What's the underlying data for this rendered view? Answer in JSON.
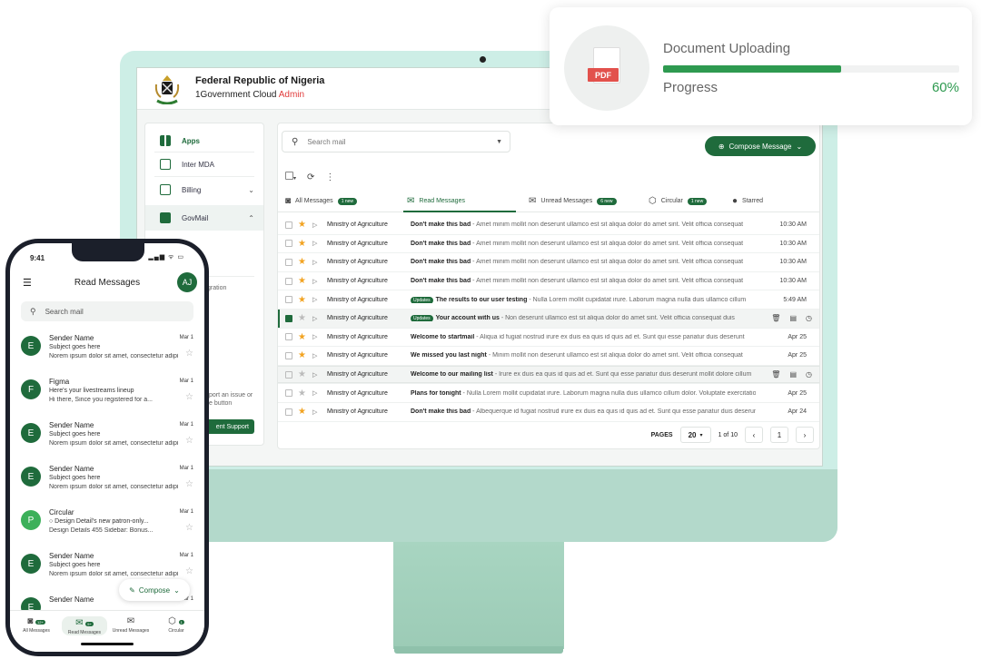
{
  "upload": {
    "title": "Document Uploading",
    "file_type": "PDF",
    "progress_label": "Progress",
    "progress_text": "60%",
    "progress_fraction": 0.6
  },
  "app": {
    "title": "Federal Republic of Nigeria",
    "subtitle": "1Government Cloud",
    "subtitle_accent": "Admin"
  },
  "sidebar": {
    "items": [
      {
        "label": "Apps",
        "icon": "apps-grid-icon"
      },
      {
        "label": "Inter MDA",
        "icon": "document-icon"
      },
      {
        "label": "Billing",
        "icon": "billing-icon",
        "chevron": "⌄"
      },
      {
        "label": "GovMail",
        "icon": "mail-icon",
        "chevron": "⌃"
      }
    ],
    "fragment_1": "gration",
    "fragment_2": "port an issue or",
    "fragment_3": "e button",
    "support_button": "ent Support"
  },
  "mail": {
    "search_placeholder": "Search mail",
    "compose_label": "Compose Message",
    "tabs": [
      {
        "label": "All Messages",
        "badge": "1 new",
        "icon": "inbox-icon"
      },
      {
        "label": "Read Messages",
        "badge": "",
        "icon": "open-mail-icon"
      },
      {
        "label": "Unread Messages",
        "badge": "6 new",
        "icon": "unread-mail-icon"
      },
      {
        "label": "Circular",
        "badge": "1 new",
        "icon": "circular-icon"
      },
      {
        "label": "Starred",
        "badge": "",
        "icon": "info-icon"
      }
    ],
    "rows": [
      {
        "sender": "Ministry of Agriculture",
        "tag": "",
        "subject": "Don't make this bad",
        "preview": " - Amet minim mollit non deserunt ullamco est sit aliqua dolor do amet sint. Velit officia consequat",
        "time": "10:30 AM",
        "starred": true,
        "checked": false
      },
      {
        "sender": "Ministry of Agriculture",
        "tag": "",
        "subject": "Don't make this bad",
        "preview": " - Amet minim mollit non deserunt ullamco est sit aliqua dolor do amet sint. Velit officia consequat",
        "time": "10:30 AM",
        "starred": true,
        "checked": false
      },
      {
        "sender": "Ministry of Agriculture",
        "tag": "",
        "subject": "Don't make this bad",
        "preview": " - Amet minim mollit non deserunt ullamco est sit aliqua dolor do amet sint. Velit officia consequat",
        "time": "10:30 AM",
        "starred": true,
        "checked": false
      },
      {
        "sender": "Ministry of Agriculture",
        "tag": "",
        "subject": "Don't make this bad",
        "preview": " - Amet minim mollit non deserunt ullamco est sit aliqua dolor do amet sint. Velit officia consequat",
        "time": "10:30 AM",
        "starred": true,
        "checked": false
      },
      {
        "sender": "Ministry of Agriculture",
        "tag": "Updates",
        "subject": "The results to our user testing",
        "preview": " - Nulla Lorem mollit cupidatat irure. Laborum magna nulla duis ullamco cillum",
        "time": "5:49 AM",
        "starred": true,
        "checked": false
      },
      {
        "sender": "Ministry of Agriculture",
        "tag": "Updates",
        "subject": "Your account with us",
        "preview": " - Non deserunt ullamco est sit aliqua dolor do amet sint. Velit officia consequat duis",
        "time": "",
        "starred": false,
        "checked": true
      },
      {
        "sender": "Ministry of Agriculture",
        "tag": "",
        "subject": "Welcome to startmail",
        "preview": " - Aliqua id fugiat nostrud irure ex duis ea quis id quis ad et. Sunt qui esse pariatur duis deserunt",
        "time": "Apr 25",
        "starred": true,
        "checked": false
      },
      {
        "sender": "Ministry of Agriculture",
        "tag": "",
        "subject": "We missed you last night",
        "preview": " - Minim mollit non deserunt ullamco est sit aliqua dolor do amet sint. Velit officia consequat",
        "time": "Apr 25",
        "starred": true,
        "checked": false
      },
      {
        "sender": "Ministry of Agriculture",
        "tag": "",
        "subject": "Welcome to our mailing list",
        "preview": " - Irure ex duis ea quis id quis ad et. Sunt qui esse pariatur duis deserunt mollit dolore cillum",
        "time": "",
        "starred": false,
        "checked": false
      },
      {
        "sender": "Ministry of Agriculture",
        "tag": "",
        "subject": "Plans for tonight",
        "preview": " - Nulla Lorem mollit cupidatat irure. Laborum magna nulla duis ullamco cillum dolor. Voluptate exercitation",
        "time": "Apr 25",
        "starred": false,
        "checked": false
      },
      {
        "sender": "Ministry of Agriculture",
        "tag": "",
        "subject": "Don't make this bad",
        "preview": " - Albequerque id fugiat nostrud irure ex duis ea quis id quis ad et. Sunt qui esse pariatur duis deserunt",
        "time": "Apr 24",
        "starred": true,
        "checked": false
      }
    ],
    "pager": {
      "label": "PAGES",
      "per_page": "20",
      "range": "1 of 10",
      "current": "1"
    }
  },
  "phone": {
    "time": "9:41",
    "status": "▂▄▆ ᯤ ▭",
    "title": "Read Messages",
    "avatar": "AJ",
    "search_placeholder": "Search mail",
    "items": [
      {
        "initial": "E",
        "name": "Sender Name",
        "date": "Mar 1",
        "subject": "Subject goes here",
        "preview": "Norem ipsum dolor sit amet, consectetur adipiscing",
        "light": false
      },
      {
        "initial": "F",
        "name": "Figma",
        "date": "Mar 1",
        "subject": "Here's your livestreams lineup",
        "preview": "Hi there, Since you registered for a...",
        "light": false
      },
      {
        "initial": "E",
        "name": "Sender Name",
        "date": "Mar 1",
        "subject": "Subject goes here",
        "preview": "Norem ipsum dolor sit amet, consectetur adipiscing",
        "light": false
      },
      {
        "initial": "E",
        "name": "Sender Name",
        "date": "Mar 1",
        "subject": "Subject goes here",
        "preview": "Norem ipsum dolor sit amet, consectetur adipiscing",
        "light": false
      },
      {
        "initial": "P",
        "name": "Circular",
        "date": "Mar 1",
        "subject": "○ Design Detail's new patron-only...",
        "preview": "Design Details 455 Sidebar: Bonus...",
        "light": true
      },
      {
        "initial": "E",
        "name": "Sender Name",
        "date": "Mar 1",
        "subject": "Subject goes here",
        "preview": "Norem ipsum dolor sit amet, consectetur adipiscing",
        "light": false
      },
      {
        "initial": "E",
        "name": "Sender Name",
        "date": "Mar 1",
        "subject": "",
        "preview": "",
        "light": false
      }
    ],
    "compose_label": "Compose",
    "nav": [
      {
        "label": "All Messages",
        "badge": "12+"
      },
      {
        "label": "Read Messages",
        "badge": "5+"
      },
      {
        "label": "Unread Messages",
        "badge": ""
      },
      {
        "label": "Circular",
        "badge": "1"
      }
    ]
  }
}
